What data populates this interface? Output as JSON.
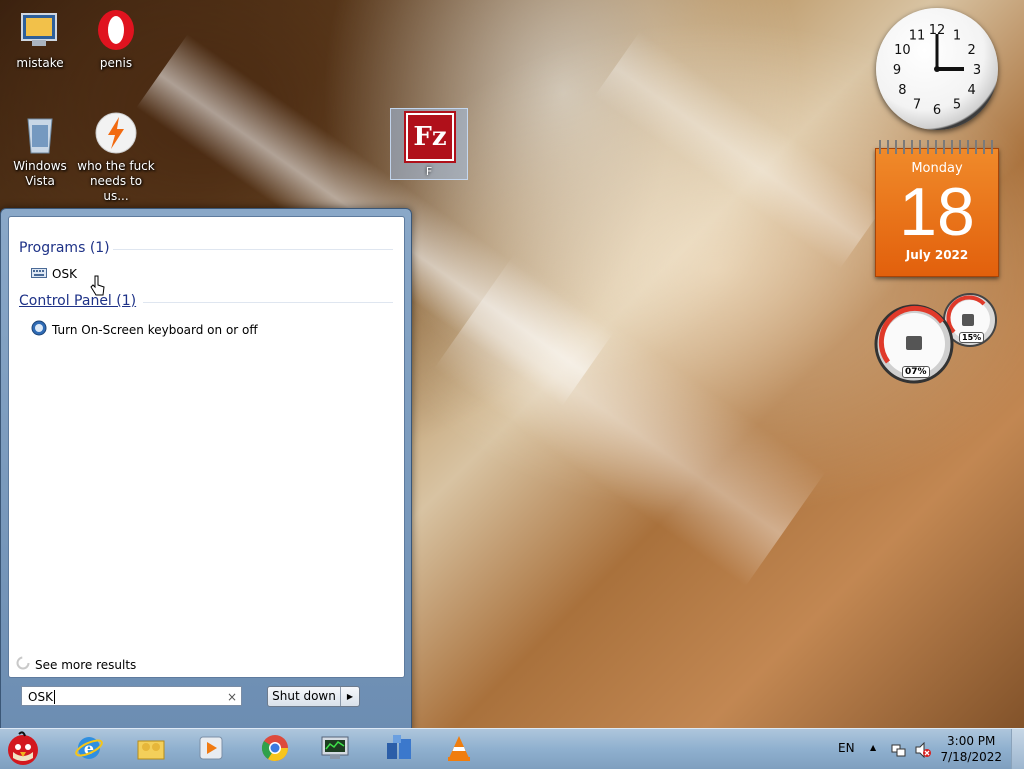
{
  "desktop": {
    "icons": [
      {
        "label": "mistake",
        "icon": "computer-folder-icon"
      },
      {
        "label": "penis",
        "icon": "opera-browser-icon"
      },
      {
        "label": "Windows Vista",
        "icon": "recycle-bin-icon"
      },
      {
        "label": "who the fuck needs to us...",
        "icon": "flash-player-icon"
      },
      {
        "label": "F",
        "icon": "filezilla-icon",
        "glyph": "Fz"
      }
    ]
  },
  "gadgets": {
    "clock": {
      "time": "3:00",
      "numerals": [
        "12",
        "1",
        "2",
        "3",
        "4",
        "5",
        "6",
        "7",
        "8",
        "9",
        "10",
        "11"
      ]
    },
    "calendar": {
      "weekday": "Monday",
      "day": "18",
      "month_year": "July 2022"
    },
    "meters": {
      "cpu": "07%",
      "memory": "15%"
    }
  },
  "start_menu": {
    "groups": [
      {
        "title": "Programs (1)",
        "items": [
          {
            "label": "OSK",
            "icon": "keyboard-icon"
          }
        ]
      },
      {
        "title": "Control Panel (1)",
        "items": [
          {
            "label": "Turn On-Screen keyboard on or off",
            "icon": "ease-of-access-icon"
          }
        ]
      }
    ],
    "see_more": "See more results",
    "search_value": "OSK",
    "search_clear": "×",
    "shutdown_label": "Shut down",
    "shutdown_arrow": "▶"
  },
  "taskbar": {
    "pinned": [
      {
        "name": "start-orb",
        "icon": "angry-bird-icon"
      },
      {
        "name": "internet-explorer",
        "icon": "ie-icon"
      },
      {
        "name": "windows-explorer",
        "icon": "folder-icon"
      },
      {
        "name": "media-player",
        "icon": "media-player-icon"
      },
      {
        "name": "chrome",
        "icon": "chrome-icon"
      },
      {
        "name": "task-manager",
        "icon": "monitor-icon"
      },
      {
        "name": "network-app",
        "icon": "network-icon"
      },
      {
        "name": "vlc",
        "icon": "vlc-icon"
      }
    ],
    "language": "EN",
    "tray_expand": "▲",
    "time": "3:00 PM",
    "date": "7/18/2022"
  },
  "colors": {
    "start_menu_frame": "#7b9bbf",
    "group_title": "#1e3287",
    "calendar": "#e8701a",
    "taskbar": "#96b4d2"
  }
}
